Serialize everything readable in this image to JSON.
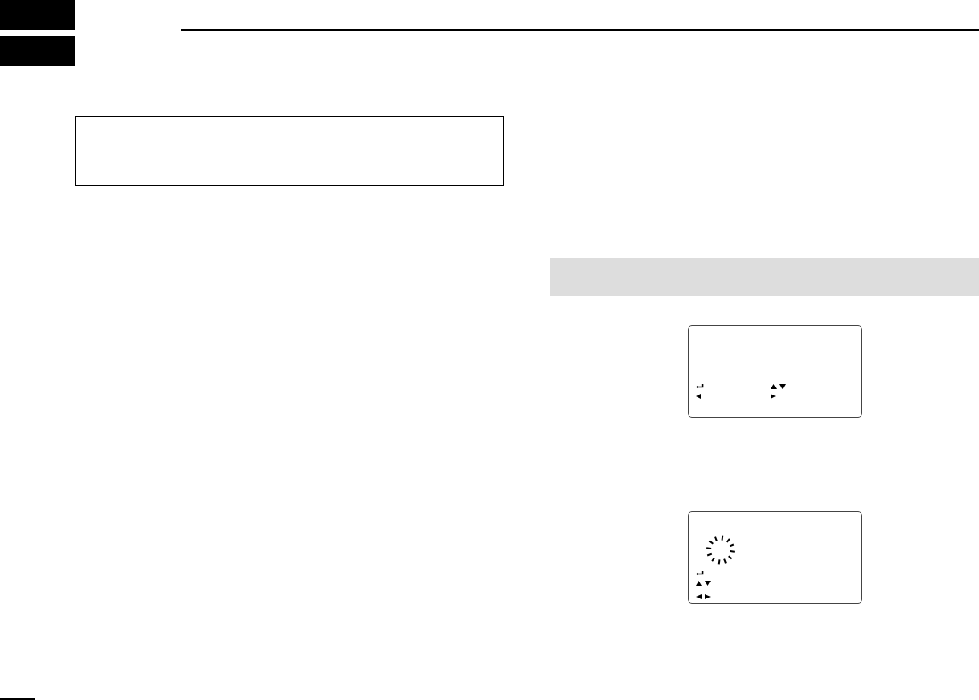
{
  "lcd_screens": [
    {
      "kind": "grid",
      "icons": [
        {
          "kind": "enter"
        },
        {
          "kind": "up_down"
        },
        {
          "kind": "left"
        },
        {
          "kind": "right"
        }
      ]
    },
    {
      "kind": "column",
      "icons": [
        {
          "kind": "spinner"
        },
        {
          "kind": "enter"
        },
        {
          "kind": "up_down"
        },
        {
          "kind": "left_right"
        }
      ]
    }
  ]
}
